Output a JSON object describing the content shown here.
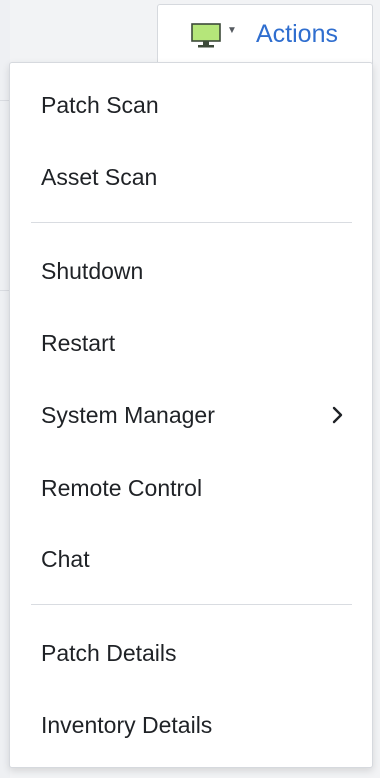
{
  "header": {
    "actions_label": "Actions",
    "device_icon": "monitor-icon",
    "dropdown_icon": "caret-down-icon"
  },
  "menu": {
    "items": [
      {
        "label": "Patch Scan"
      },
      {
        "label": "Asset Scan"
      },
      {
        "label": "Shutdown"
      },
      {
        "label": "Restart"
      },
      {
        "label": "System Manager",
        "icon": "chevron-right-icon"
      },
      {
        "label": "Remote Control"
      },
      {
        "label": "Chat"
      },
      {
        "label": "Patch Details"
      },
      {
        "label": "Inventory Details"
      }
    ]
  },
  "colors": {
    "accent": "#2f6ecf",
    "monitor_screen": "#b5e67a",
    "text": "#1f2226",
    "divider": "#d9dce1"
  }
}
